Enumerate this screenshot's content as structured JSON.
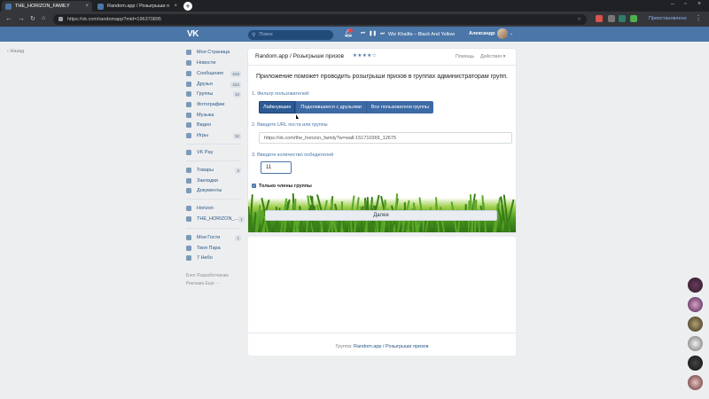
{
  "browser": {
    "tabs": [
      {
        "label": "THE_HORIZON_FAMILY",
        "active": true
      },
      {
        "label": "Random.app / Розыгрыши п",
        "active": false
      }
    ],
    "url": "https://vk.com/randomapp?mid=196370895",
    "extension_label": "Приостановлено",
    "new_tab_glyph": "+"
  },
  "header": {
    "logo": "VK",
    "search_placeholder": "Поиск",
    "notifications_icon": "bell-icon",
    "now_playing": "Wiz Khalifa – Black And Yellow",
    "username": "Александр"
  },
  "back_link": "Назад",
  "sidebar": {
    "items": [
      {
        "label": "Моя Страница",
        "badge": ""
      },
      {
        "label": "Новости",
        "badge": ""
      },
      {
        "label": "Сообщения",
        "badge": "648"
      },
      {
        "label": "Друзья",
        "badge": "154"
      },
      {
        "label": "Группы",
        "badge": "15"
      },
      {
        "label": "Фотографии",
        "badge": ""
      },
      {
        "label": "Музыка",
        "badge": ""
      },
      {
        "label": "Видео",
        "badge": ""
      },
      {
        "label": "Игры",
        "badge": "32"
      }
    ],
    "items2": [
      {
        "label": "VK Pay",
        "badge": ""
      }
    ],
    "items3": [
      {
        "label": "Товары",
        "badge": "3"
      },
      {
        "label": "Закладки",
        "badge": ""
      },
      {
        "label": "Документы",
        "badge": ""
      }
    ],
    "items4": [
      {
        "label": "Horizon",
        "badge": ""
      },
      {
        "label": "THE_HORIZON_...",
        "badge": "1"
      }
    ],
    "items5": [
      {
        "label": "Мои Гости",
        "badge": "1"
      },
      {
        "label": "Твоя Пара",
        "badge": ""
      },
      {
        "label": "7 Небо",
        "badge": ""
      }
    ],
    "footer_line1": "Блог   Разработчикам",
    "footer_line2": "Реклама   Ещё ···"
  },
  "app": {
    "title": "Random.app / Розыгрыши призов",
    "stars": "★★★★☆",
    "help": "Помощь",
    "actions": "Действия ▾",
    "description": "Приложение поможет проводить розыгрыши призов в группах администраторам групп.",
    "step1_label": "1. Фильтр пользователей:",
    "filters": [
      "Лайкнувшие",
      "Поделившиеся с друзьями",
      "Все пользователи группы"
    ],
    "selected_filter": "Лайкнувшие",
    "step2_label": "2. Введите URL поста или группы",
    "url_value": "https://vk.com/the_horizon_family?w=wall-151710365_12675",
    "step3_label": "3. Введите количество победителей",
    "winners_value": "11",
    "only_members_label": "Только члены группы",
    "only_members_checked": true,
    "next_button": "Далее"
  },
  "footer": {
    "prefix": "Группа: ",
    "link": "Random.app / Розыгрыши призов"
  },
  "colors": {
    "vk_blue": "#4a76a8",
    "button_blue": "#3c6aa5",
    "link": "#2a5885",
    "page_bg": "#edeef0"
  }
}
